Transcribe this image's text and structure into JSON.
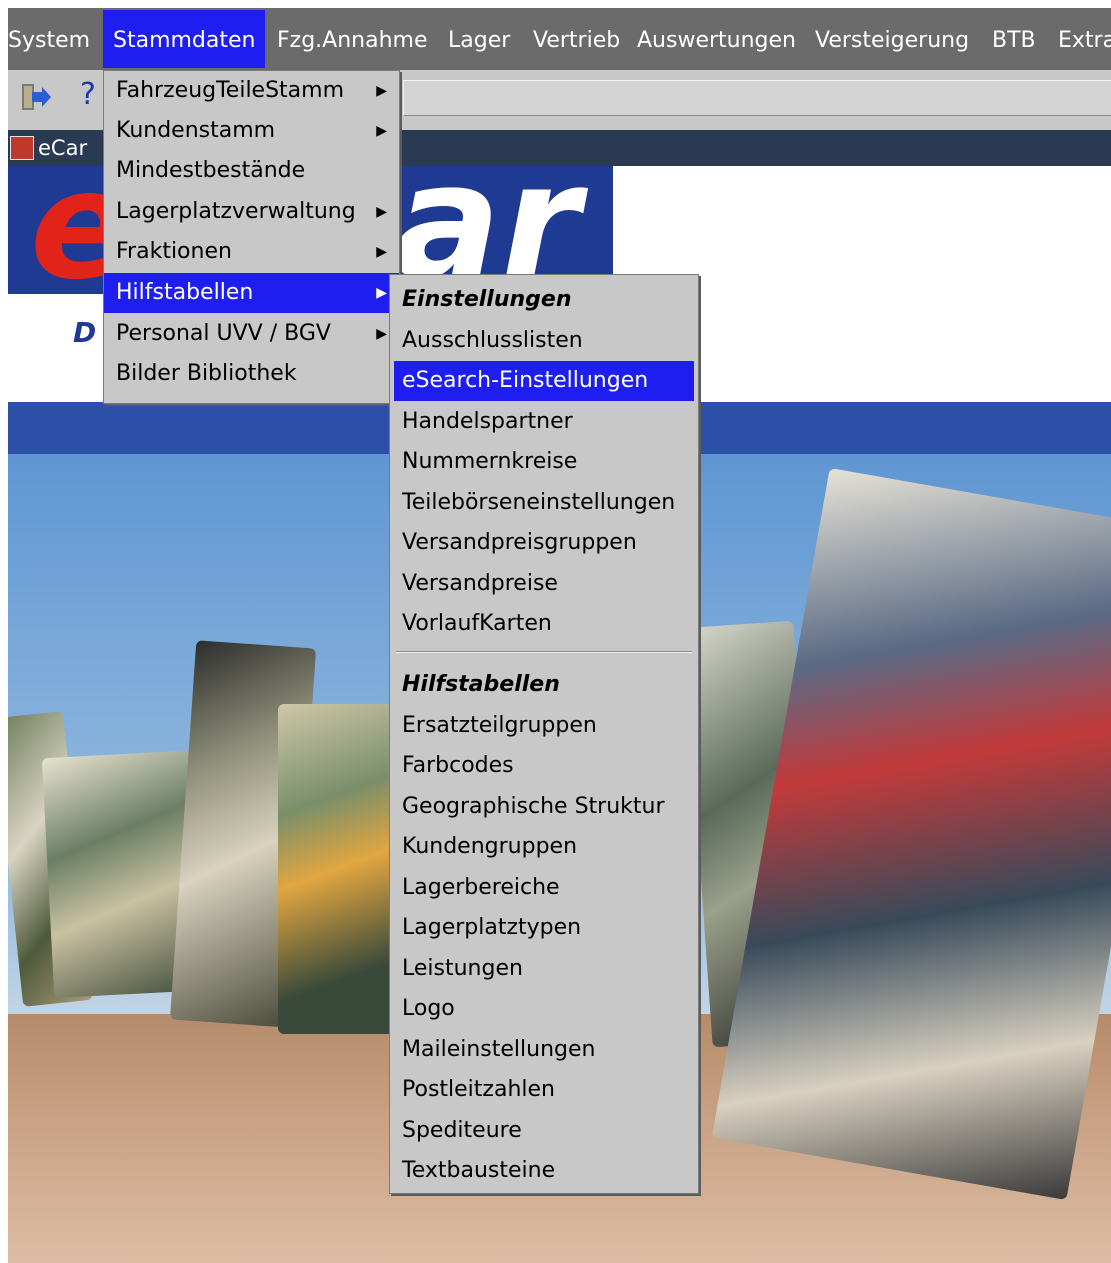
{
  "menubar": {
    "items": [
      "System",
      "Stammdaten",
      "Fzg.Annahme",
      "Lager",
      "Vertrieb",
      "Auswertungen",
      "Versteigerung",
      "BTB",
      "Extra"
    ]
  },
  "toolbar": {
    "icons": [
      "exit-icon",
      "help-icon"
    ],
    "help_glyph": "?"
  },
  "window": {
    "title": "eCar"
  },
  "banner": {
    "logo_e": "e",
    "logo_rest": "ar",
    "tagline": "D"
  },
  "stammdaten_menu": {
    "items": [
      {
        "label": "FahrzeugTeileStamm",
        "submenu": true
      },
      {
        "label": "Kundenstamm",
        "submenu": true
      },
      {
        "label": "Mindestbestände",
        "submenu": false
      },
      {
        "label": "Lagerplatzverwaltung",
        "submenu": true
      },
      {
        "label": "Fraktionen",
        "submenu": true
      },
      {
        "label": "Hilfstabellen",
        "submenu": true,
        "highlighted": true
      },
      {
        "label": "Personal UVV / BGV",
        "submenu": true
      },
      {
        "label": "Bilder Bibliothek",
        "submenu": false
      }
    ]
  },
  "hilfstabellen_menu": {
    "einstellungen_heading": "Einstellungen",
    "einstellungen_items": [
      "Ausschlusslisten",
      "eSearch-Einstellungen",
      "Handelspartner",
      "Nummernkreise",
      "Teilebörseneinstellungen",
      "Versandpreisgruppen",
      "Versandpreise",
      "VorlaufKarten"
    ],
    "highlighted": "eSearch-Einstellungen",
    "hilfstabellen_heading": "Hilfstabellen",
    "hilfstabellen_items": [
      "Ersatzteilgruppen",
      "Farbcodes",
      "Geographische Struktur",
      "Kundengruppen",
      "Lagerbereiche",
      "Lagerplatztypen",
      "Leistungen",
      "Logo",
      "Maileinstellungen",
      "Postleitzahlen",
      "Spediteure",
      "Textbausteine"
    ]
  },
  "colors": {
    "menubar": "#6b6b6b",
    "highlight": "#1e1ef0",
    "menu_bg": "#c8c8c8",
    "logo_blue": "#1f3a93",
    "logo_red": "#e2231a"
  }
}
